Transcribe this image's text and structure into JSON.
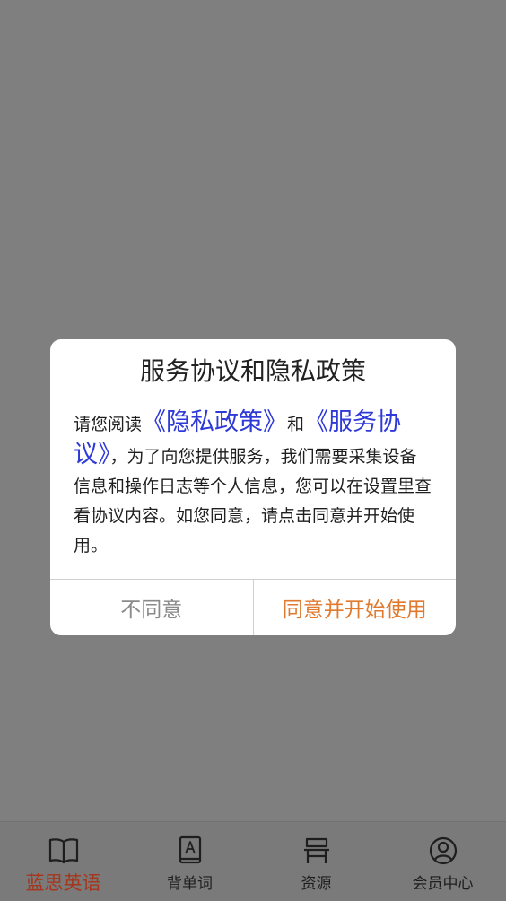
{
  "dialog": {
    "title": "服务协议和隐私政策",
    "body": {
      "part1": "请您阅读",
      "privacy_link": "《隐私政策》",
      "part2": "和",
      "service_link": "《服务协议》",
      "part3": "，为了向您提供服务，我们需要采集设备信息和操作日志等个人信息，您可以在设置里查看协议内容。如您同意，请点击同意并开始使用。"
    },
    "disagree_label": "不同意",
    "agree_label": "同意并开始使用"
  },
  "tabbar": {
    "items": [
      {
        "label": "蓝思英语",
        "icon": "book-open-icon",
        "active": true
      },
      {
        "label": "背单词",
        "icon": "vocabulary-book-icon",
        "active": false
      },
      {
        "label": "资源",
        "icon": "desk-chair-icon",
        "active": false
      },
      {
        "label": "会员中心",
        "icon": "user-circle-icon",
        "active": false
      }
    ]
  },
  "colors": {
    "overlay": "#7f7f7f",
    "link": "#2e39d8",
    "agree": "#e07a2f",
    "disagree": "#8a8a8a",
    "active_tab": "#a6361c"
  }
}
